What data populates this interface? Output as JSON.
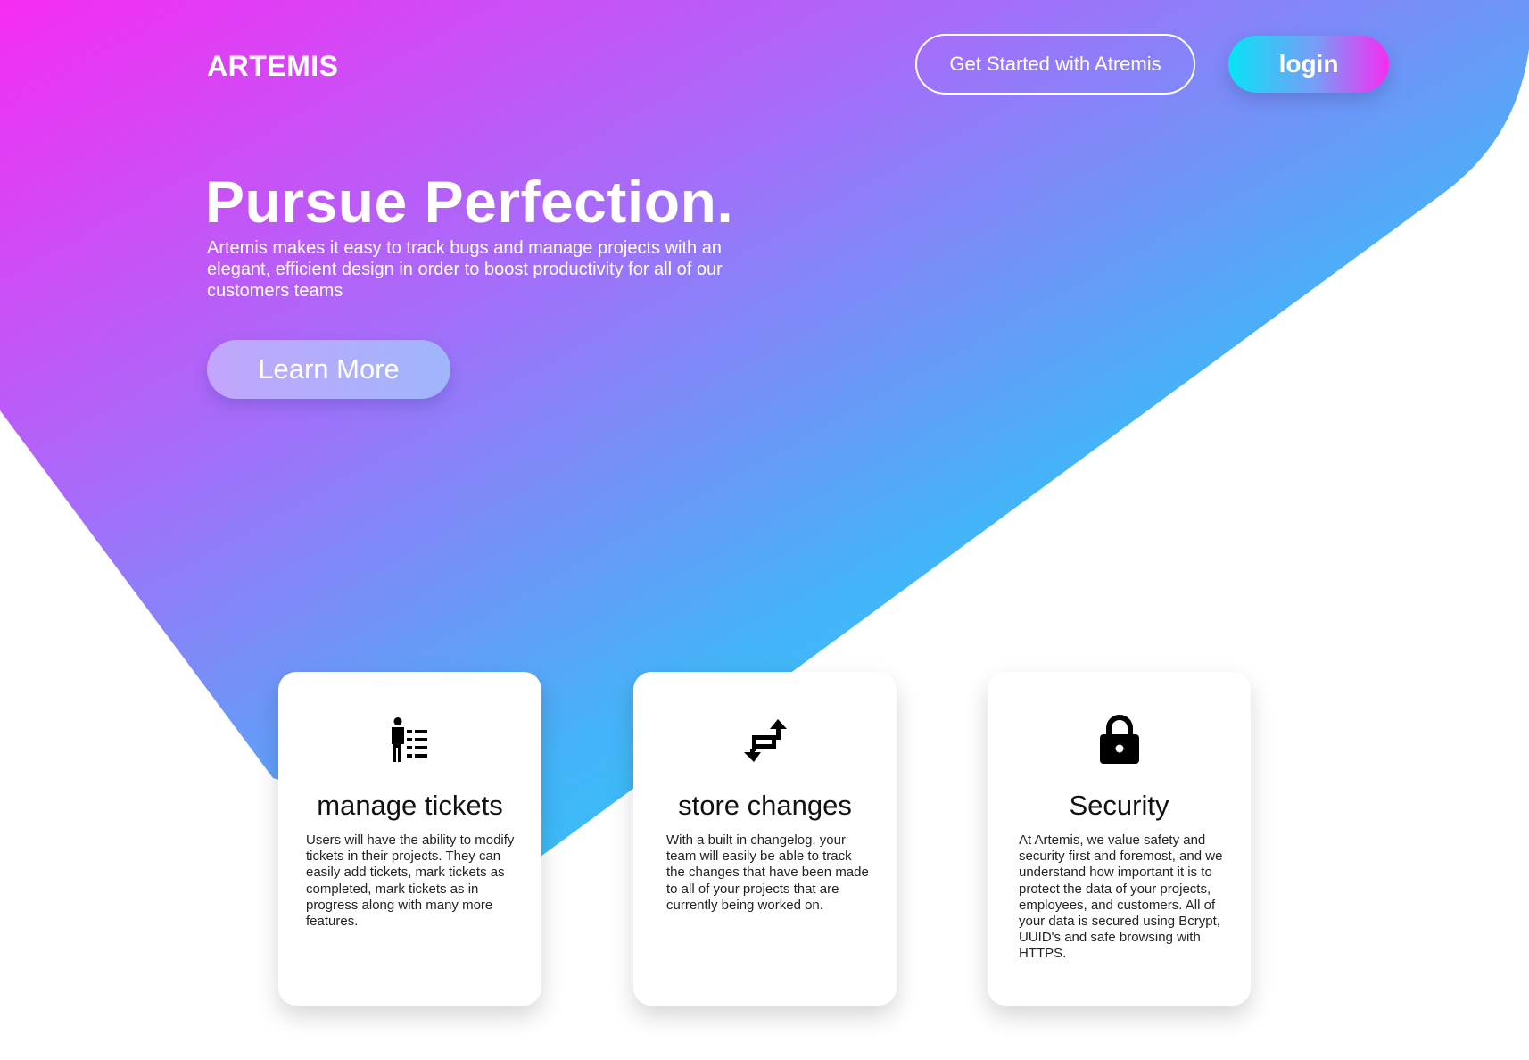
{
  "header": {
    "logo": "ARTEMIS",
    "get_started_label": "Get Started with Atremis",
    "login_label": "login"
  },
  "hero": {
    "title": "Pursue Perfection.",
    "description": "Artemis makes it easy to track bugs and manage projects with an elegant, efficient design in order to boost productivity for all of our customers teams",
    "learn_more_label": "Learn More"
  },
  "features": [
    {
      "icon": "manage-tickets-icon",
      "title": "manage tickets",
      "text": "Users will have the ability to modify tickets in their projects. They can easily add tickets, mark tickets as completed, mark tickets as in progress along with many more features."
    },
    {
      "icon": "store-changes-icon",
      "title": "store changes",
      "text": "With a built in changelog, your team will easily be able to track the changes that have been made to all of your projects that are currently being worked on."
    },
    {
      "icon": "lock-icon",
      "title": "Security",
      "text": "At Artemis, we value safety and security first and foremost, and we understand how important it is to protect the data of your projects, employees, and customers. All of your data is secured using Bcrypt, UUID's and safe browsing with HTTPS."
    }
  ],
  "colors": {
    "gradient_magenta": "#f62cf2",
    "gradient_violet": "#a76cf9",
    "gradient_cyan": "#08e3f5"
  }
}
